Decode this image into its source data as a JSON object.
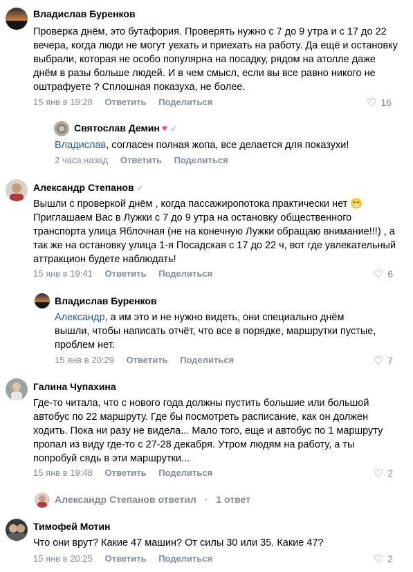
{
  "comments": [
    {
      "author": "Владислав Буренков",
      "text": "Проверка днём, это бутафория. Проверять нужно с 7 до 9 утра и с 17 до 22 вечера, когда люди не могут уехать и приехать на работу. Да ещё и остановку выбрали, которая не особо популярна на посадку, рядом на атолле даже днём в разы больше людей. И в чем смысл, если вы все равно никого не оштрафуете ? Сплошная показуха, не более.",
      "date": "15 янв в 19:28",
      "reply_label": "Ответить",
      "share_label": "Поделиться",
      "likes": "16"
    },
    {
      "author": "Святослав Демин",
      "badge": "♥",
      "verified": "✓",
      "mention": "Владислав",
      "text": ", согласен полная жопа, все делается для показухи!",
      "date": "2 часа назад",
      "reply_label": "Ответить",
      "share_label": "Поделиться"
    },
    {
      "author": "Александр Степанов",
      "verified": "✓",
      "text": "Вышли с проверкой днём , когда пассажиропотока практически нет 😁 Приглашаем Вас в Лужки с 7 до 9 утра на остановку общественного транспорта улица Яблочная (не на конечную Лужки обращаю внимание!!!) , а так же на остановку улица 1-я Посадская с 17 до 22 ч, вот где увлекательный аттракцион будете наблюдать!",
      "date": "15 янв в 19:41",
      "reply_label": "Ответить",
      "share_label": "Поделиться",
      "likes": "6"
    },
    {
      "author": "Владислав Буренков",
      "mention": "Александр",
      "text": ", а им это и не нужно видеть, они специально днём вышли, чтобы написать отчёт, что все в порядке, маршрутки пустые, проблем нет.",
      "date": "15 янв в 20:29",
      "reply_label": "Ответить",
      "share_label": "Поделиться",
      "likes": "7"
    },
    {
      "author": "Галина Чупахина",
      "text": "Где-то читала, что с нового года должны пустить большие или большой автобус по 22 маршруту. Где бы посмотреть расписание, как он должен ходить. Пока ни разу не видела... Мало того, еще и автобус по 1 маршруту пропал из виду где-то с 27-28 декабря. Утром людям на работу, а ты попробуй сядь в эти маршрутки...",
      "date": "15 янв в 19:48",
      "reply_label": "Ответить",
      "share_label": "Поделиться",
      "likes": "2"
    },
    {
      "author": "Тимофей Мотин",
      "text": "Что они врут? Какие 47 машин? От силы 30 или 35. Какие 47?",
      "date": "15 янв в 20:25",
      "reply_label": "Ответить",
      "share_label": "Поделиться",
      "likes": "2"
    }
  ],
  "thread": {
    "replier": "Александр Степанов ответил",
    "separator": "·",
    "count": "1 ответ"
  },
  "colors": {
    "text": "#000000",
    "secondary": "#818c99",
    "link": "#2a5885"
  }
}
